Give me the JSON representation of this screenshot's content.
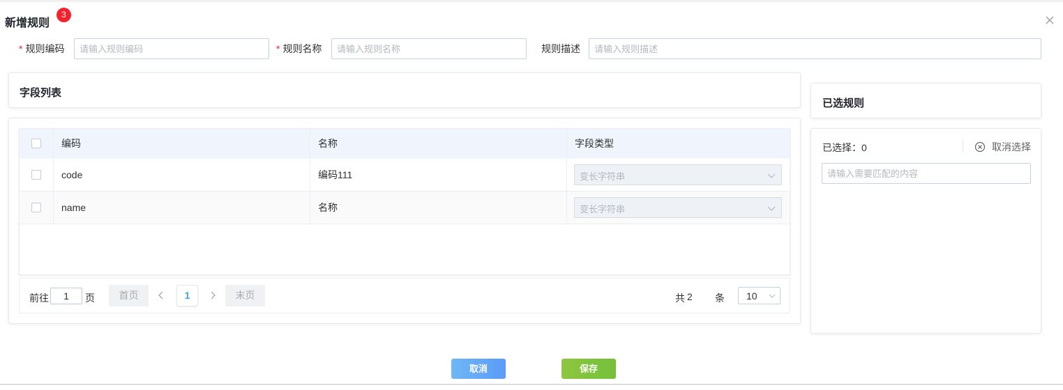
{
  "dialog": {
    "title": "新增规则",
    "badge": "3",
    "close_icon": "close-icon"
  },
  "form": {
    "code": {
      "required_mark": "*",
      "label": "规则编码",
      "placeholder": "请输入规则编码",
      "value": ""
    },
    "name": {
      "required_mark": "*",
      "label": "规则名称",
      "placeholder": "请输入规则名称",
      "value": ""
    },
    "desc": {
      "label": "规则描述",
      "placeholder": "请输入规则描述",
      "value": ""
    }
  },
  "field_list": {
    "title": "字段列表",
    "columns": [
      "编码",
      "名称",
      "字段类型"
    ],
    "rows": [
      {
        "code": "code",
        "name": "编码111",
        "type": "变长字符串"
      },
      {
        "code": "name",
        "name": "名称",
        "type": "变长字符串"
      }
    ]
  },
  "pagination": {
    "goto_prefix": "前往",
    "goto_value": "1",
    "goto_suffix": "页",
    "first": "首页",
    "current": "1",
    "last": "末页",
    "total_prefix": "共",
    "total": "2",
    "total_suffix": "条",
    "page_size": "10"
  },
  "selected_rules": {
    "title": "已选规则",
    "count_label": "已选择：0",
    "clear_label": "取消选择",
    "search_placeholder": "请输入需要匹配的内容"
  },
  "footer": {
    "cancel_label": "取消",
    "save_label": "保存"
  },
  "colors": {
    "primary": "#409eff",
    "danger": "#f5222d",
    "save": "#7dc23c",
    "cancel": "#62a7f7",
    "header_bg": "#eff4fd"
  }
}
